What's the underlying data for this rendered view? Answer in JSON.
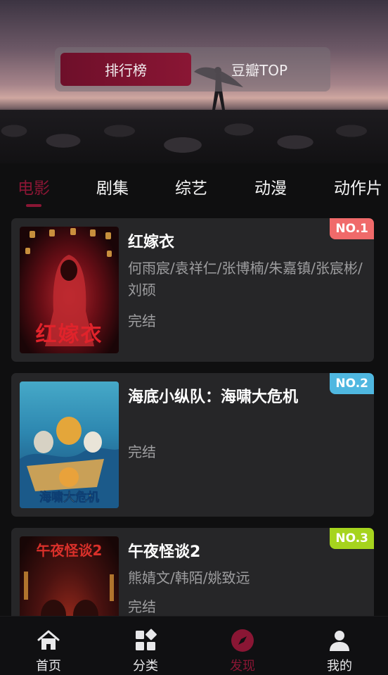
{
  "hero": {
    "segments": [
      {
        "label": "排行榜",
        "active": true
      },
      {
        "label": "豆瓣TOP",
        "active": false
      }
    ]
  },
  "tabs": [
    {
      "label": "电影",
      "active": true
    },
    {
      "label": "剧集",
      "active": false
    },
    {
      "label": "综艺",
      "active": false
    },
    {
      "label": "动漫",
      "active": false
    },
    {
      "label": "动作片",
      "active": false
    }
  ],
  "ranking": [
    {
      "rank": "NO.1",
      "rank_color": "#f06a6a",
      "title": "红嫁衣",
      "cast": "何雨宸/袁祥仁/张博楠/朱嘉镇/张宸彬/刘硕",
      "status": "完结",
      "poster_text": "红嫁衣"
    },
    {
      "rank": "NO.2",
      "rank_color": "#4fb7e0",
      "title": "海底小纵队：海啸大危机",
      "cast": "",
      "status": "完结",
      "poster_text": "海啸大危机"
    },
    {
      "rank": "NO.3",
      "rank_color": "#a6d41e",
      "title": "午夜怪谈2",
      "cast": "熊婧文/韩陌/姚致远",
      "status": "完结",
      "poster_text": "午夜怪谈2"
    }
  ],
  "nav": [
    {
      "label": "首页",
      "icon": "home-icon",
      "active": false
    },
    {
      "label": "分类",
      "icon": "category-icon",
      "active": false
    },
    {
      "label": "发现",
      "icon": "compass-icon",
      "active": true
    },
    {
      "label": "我的",
      "icon": "user-icon",
      "active": false
    }
  ],
  "colors": {
    "accent": "#8a1634",
    "card_bg": "#262628",
    "page_bg": "#0f0f10",
    "muted_text": "#9d9d9f"
  }
}
